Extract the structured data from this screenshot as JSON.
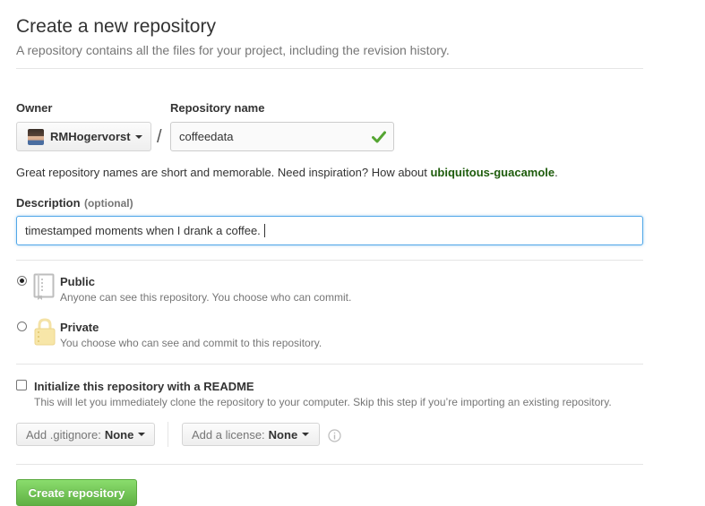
{
  "header": {
    "title": "Create a new repository",
    "description": "A repository contains all the files for your project, including the revision history."
  },
  "owner": {
    "label": "Owner",
    "name": "RMHogervorst"
  },
  "repo": {
    "label": "Repository name",
    "value": "coffeedata",
    "separator": "/"
  },
  "suggestion": {
    "text": "Great repository names are short and memorable. Need inspiration? How about ",
    "name": "ubiquitous-guacamole",
    "suffix": "."
  },
  "description": {
    "label": "Description",
    "optional": "(optional)",
    "value": "timestamped moments  when I drank a coffee."
  },
  "visibility": {
    "public_label": "Public",
    "public_desc": "Anyone can see this repository. You choose who can commit.",
    "private_label": "Private",
    "private_desc": "You choose who can see and commit to this repository.",
    "selected": "public"
  },
  "readme": {
    "label": "Initialize this repository with a README",
    "desc": "This will let you immediately clone the repository to your computer. Skip this step if you’re importing an existing repository.",
    "checked": false
  },
  "gitignore": {
    "label": "Add .gitignore:",
    "value": "None"
  },
  "license": {
    "label": "Add a license:",
    "value": "None"
  },
  "submit": {
    "label": "Create repository"
  },
  "colors": {
    "valid_check": "#55a532",
    "suggestion_link": "#1e5c0c",
    "focus_border": "#51a7e8",
    "submit_green": "#60b044"
  },
  "icons": {
    "valid": "check-icon",
    "public": "repo-icon",
    "private": "lock-icon",
    "info": "info-icon"
  }
}
